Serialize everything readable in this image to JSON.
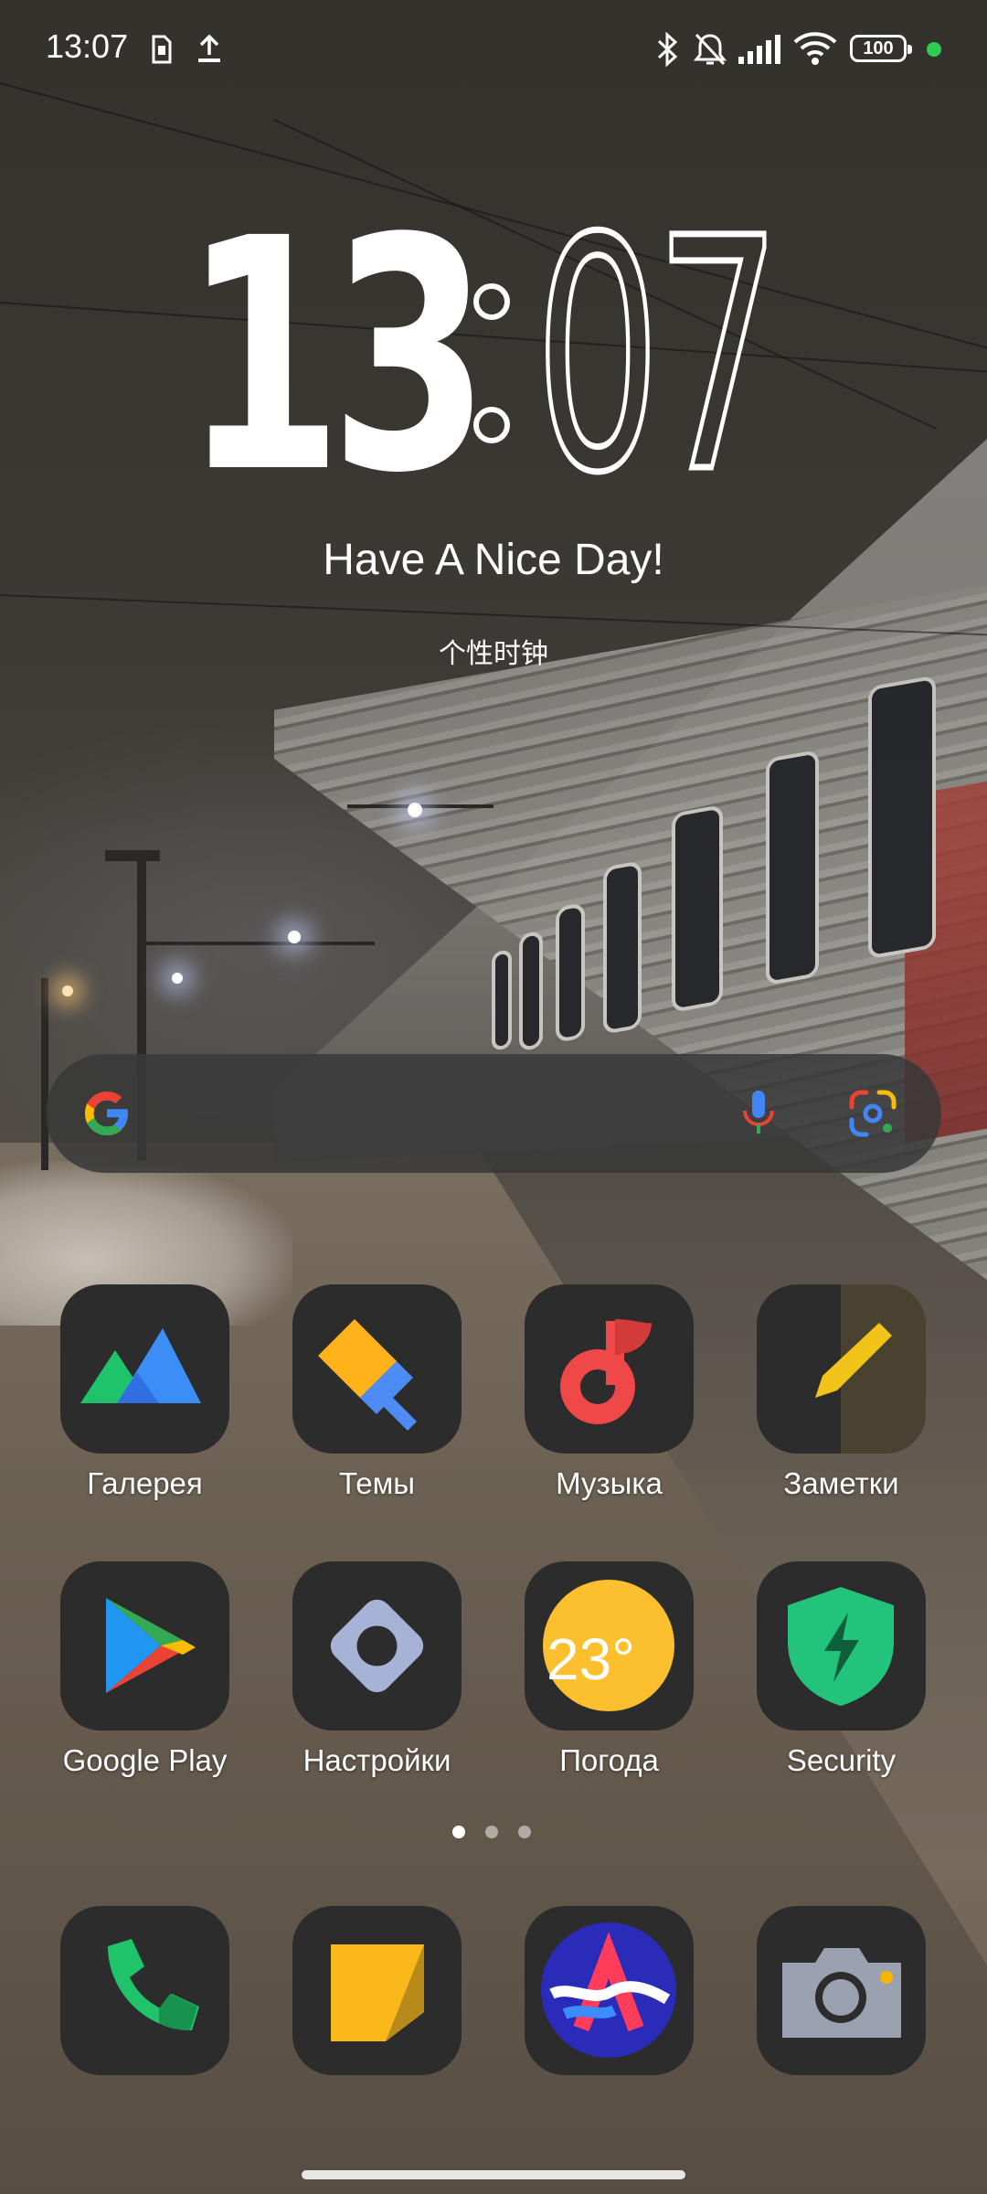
{
  "status_bar": {
    "time": "13:07",
    "battery": "100",
    "icons": [
      "sim-icon",
      "upload-icon",
      "bluetooth-icon",
      "silent-bell-icon",
      "signal-icon",
      "wifi-icon",
      "battery-icon",
      "status-dot"
    ],
    "dot_color": "#2ecc52"
  },
  "clock_widget": {
    "hour": "13",
    "minute": "07",
    "greeting": "Have A Nice Day!",
    "caption": "个性时钟"
  },
  "search_bar": {
    "icons": [
      "google-logo-icon",
      "microphone-icon",
      "google-lens-icon"
    ]
  },
  "apps": [
    {
      "label": "Галерея",
      "icon": "gallery-mountains-icon"
    },
    {
      "label": "Темы",
      "icon": "themes-brush-icon"
    },
    {
      "label": "Музыка",
      "icon": "music-note-icon"
    },
    {
      "label": "Заметки",
      "icon": "notes-pencil-icon"
    },
    {
      "label": "Google Play",
      "icon": "google-play-icon"
    },
    {
      "label": "Настройки",
      "icon": "settings-gear-icon"
    },
    {
      "label": "Погода",
      "icon": "weather-sun-icon",
      "badge": "23°"
    },
    {
      "label": "Security",
      "icon": "security-shield-icon"
    }
  ],
  "page_indicator": {
    "pages": 3,
    "current": 1
  },
  "dock": [
    {
      "icon": "phone-icon"
    },
    {
      "icon": "messages-icon"
    },
    {
      "icon": "browser-icon"
    },
    {
      "icon": "camera-icon"
    }
  ]
}
